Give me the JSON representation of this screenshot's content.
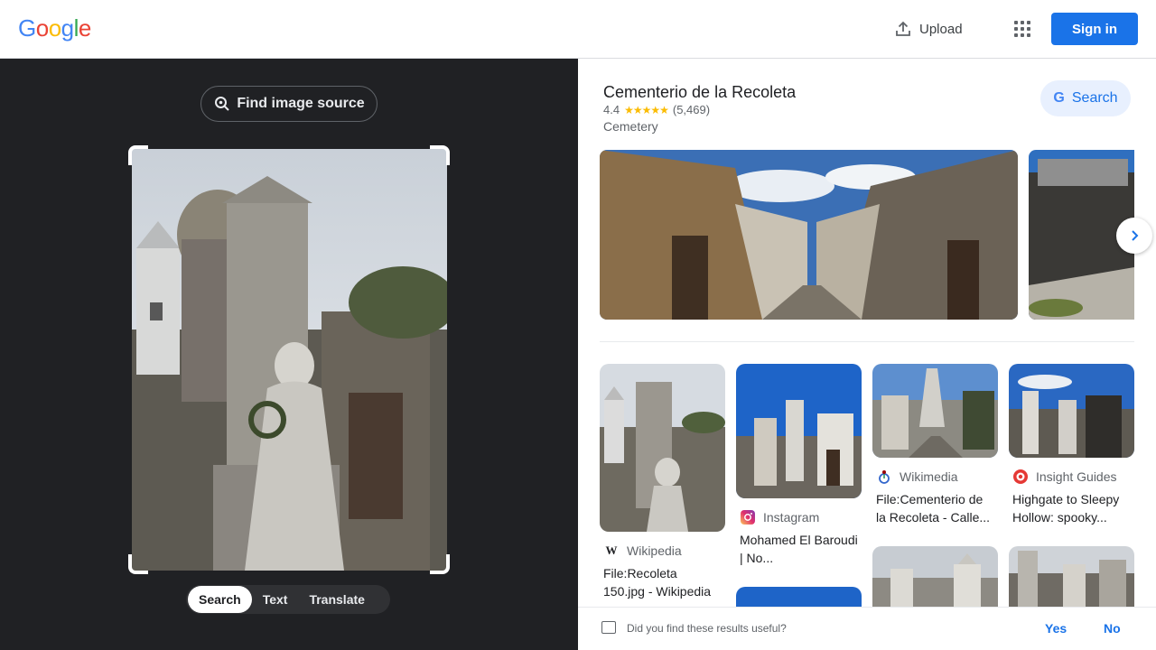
{
  "header": {
    "logo_letters": [
      {
        "ch": "G",
        "color": "#4285F4"
      },
      {
        "ch": "o",
        "color": "#EA4335"
      },
      {
        "ch": "o",
        "color": "#FBBC05"
      },
      {
        "ch": "g",
        "color": "#4285F4"
      },
      {
        "ch": "l",
        "color": "#34A853"
      },
      {
        "ch": "e",
        "color": "#EA4335"
      }
    ],
    "upload_label": "Upload",
    "apps_icon": "apps-grid-icon",
    "signin_label": "Sign in"
  },
  "left": {
    "find_source_label": "Find image source",
    "modes": [
      {
        "label": "Search",
        "active": true
      },
      {
        "label": "Text",
        "active": false
      },
      {
        "label": "Translate",
        "active": false
      }
    ]
  },
  "knowledge": {
    "title": "Cementerio de la Recoleta",
    "rating": "4.4",
    "stars": "★★★★★",
    "reviews": "(5,469)",
    "type": "Cemetery",
    "search_label": "Search"
  },
  "results": [
    {
      "source": "Wikipedia",
      "icon": "W",
      "title": "File:Recoleta 150.jpg - Wikipedia"
    },
    {
      "source": "Instagram",
      "icon": "instagram-icon",
      "title": "Mohamed El Baroudi | No..."
    },
    {
      "source": "Wikimedia",
      "icon": "wikimedia-icon",
      "title": "File:Cementerio de la Recoleta - Calle..."
    },
    {
      "source": "Insight Guides",
      "icon": "insight-guides-icon",
      "title": "Highgate to Sleepy Hollow: spooky..."
    }
  ],
  "feedback": {
    "question": "Did you find these results useful?",
    "yes": "Yes",
    "no": "No"
  },
  "colors": {
    "accent": "#1a73e8",
    "left_bg": "#202124"
  }
}
